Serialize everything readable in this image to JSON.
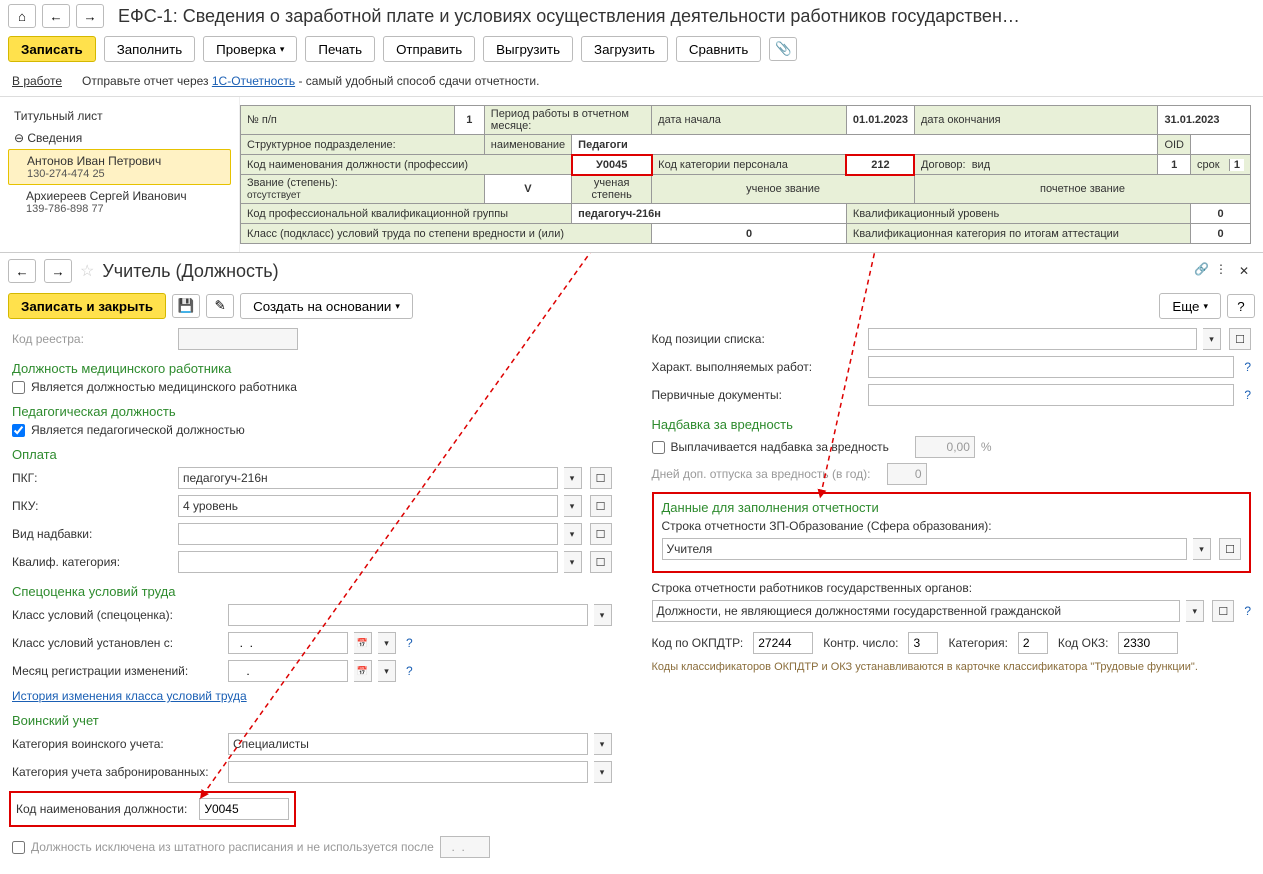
{
  "top": {
    "title": "ЕФС-1: Сведения о заработной плате и условиях осуществления деятельности работников государствен…",
    "toolbar": {
      "save": "Записать",
      "fill": "Заполнить",
      "check": "Проверка",
      "print": "Печать",
      "send": "Отправить",
      "export": "Выгрузить",
      "import": "Загрузить",
      "compare": "Сравнить"
    },
    "status": {
      "state": "В работе",
      "hint_before": "Отправьте отчет через ",
      "hint_link": "1С-Отчетность",
      "hint_after": " - самый удобный способ сдачи отчетности."
    },
    "tree": {
      "title_sheet": "Титульный лист",
      "group": "Сведения",
      "person1_name": "Антонов Иван Петрович",
      "person1_snils": "130-274-474 25",
      "person2_name": "Архиереев Сергей Иванович",
      "person2_snils": "139-786-898 77"
    },
    "grid": {
      "row1": {
        "npp_lbl": "№ п/п",
        "npp": "1",
        "period_lbl": "Период работы в отчетном месяце:",
        "date_start_lbl": "дата начала",
        "date_start": "01.01.2023",
        "date_end_lbl": "дата окончания",
        "date_end": "31.01.2023"
      },
      "row2": {
        "struct_lbl": "Структурное подразделение:",
        "name_lbl": "наименование",
        "name": "Педагоги",
        "oid_lbl": "OID"
      },
      "row3": {
        "code_lbl": "Код наименования должности (профессии)",
        "code": "У0045",
        "cat_lbl": "Код категории персонала",
        "cat": "212",
        "contract_lbl": "Договор:",
        "kind_lbl": "вид",
        "kind": "1",
        "term_lbl": "срок",
        "term": "1"
      },
      "row4": {
        "rank_lbl": "Звание (степень):",
        "rank_sub": "отсутствует",
        "v": "V",
        "degree": "ученая степень",
        "title": "ученое звание",
        "honor": "почетное звание"
      },
      "row5": {
        "pkg_lbl": "Код профессиональной квалификационной группы",
        "pkg": "педагогуч-216н",
        "level_lbl": "Квалификационный уровень",
        "level": "0"
      },
      "row6": {
        "class_lbl": "Класс (подкласс) условий труда по степени вредности и (или)",
        "class": "0",
        "att_lbl": "Квалификационная категория по итогам аттестации",
        "att": "0"
      }
    }
  },
  "bottom": {
    "title": "Учитель (Должность)",
    "toolbar": {
      "save_close": "Записать и закрыть",
      "create_based": "Создать на основании",
      "more": "Еще"
    },
    "left": {
      "registry_code_lbl": "Код реестра:",
      "sec_med": "Должность медицинского работника",
      "chk_med": "Является должностью медицинского работника",
      "sec_ped": "Педагогическая должность",
      "chk_ped": "Является педагогической должностью",
      "sec_pay": "Оплата",
      "pkg_lbl": "ПКГ:",
      "pkg": "педагогуч-216н",
      "pku_lbl": "ПКУ:",
      "pku": "4 уровень",
      "allowance_lbl": "Вид надбавки:",
      "qual_lbl": "Квалиф. категория:",
      "sec_spec": "Спецоценка условий труда",
      "class_cond_lbl": "Класс условий (спецоценка):",
      "class_date_lbl": "Класс условий установлен с:",
      "class_date": "  .  .    ",
      "month_reg_lbl": "Месяц регистрации изменений:",
      "month_reg": "    .    ",
      "history_link": "История изменения класса условий труда",
      "sec_mil": "Воинский учет",
      "mil_cat_lbl": "Категория воинского учета:",
      "mil_cat": "Специалисты",
      "mil_reserved_lbl": "Категория учета забронированных:",
      "code_pos_lbl": "Код наименования должности:",
      "code_pos": "У0045",
      "excluded_lbl": "Должность исключена из штатного расписания и не используется после",
      "excluded_date": "  .  ."
    },
    "right": {
      "list_pos_lbl": "Код позиции списка:",
      "work_char_lbl": "Характ. выполняемых работ:",
      "prim_docs_lbl": "Первичные документы:",
      "sec_hazard": "Надбавка за вредность",
      "chk_hazard": "Выплачивается надбавка за вредность",
      "hazard_val": "0,00",
      "pct": "%",
      "extra_days_lbl": "Дней доп. отпуска за вредность (в год):",
      "extra_days": "0",
      "sec_report": "Данные для заполнения отчетности",
      "edu_line_lbl": "Строка отчетности ЗП-Образование (Сфера образования):",
      "edu_line": "Учителя",
      "gov_line_lbl": "Строка отчетности работников государственных органов:",
      "gov_line": "Должности, не являющиеся должностями государственной гражданской",
      "okpdtr_lbl": "Код по ОКПДТР:",
      "okpdtr": "27244",
      "control_lbl": "Контр. число:",
      "control": "3",
      "category_lbl": "Категория:",
      "category": "2",
      "okz_lbl": "Код ОКЗ:",
      "okz": "2330",
      "classifier_note": "Коды классификаторов ОКПДТР и ОКЗ устанавливаются в карточке классификатора \"Трудовые функции\"."
    }
  }
}
